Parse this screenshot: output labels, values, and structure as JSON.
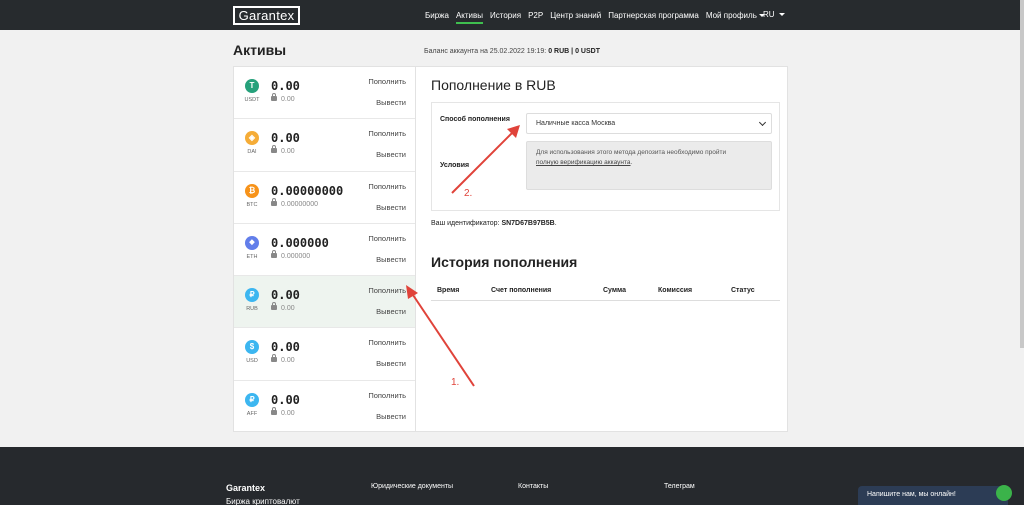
{
  "header": {
    "logo": "Garantex",
    "nav": [
      "Биржа",
      "Активы",
      "История",
      "P2P",
      "Центр знаний",
      "Партнерская программа",
      "Мой профиль"
    ],
    "active": "Активы",
    "lang": "RU"
  },
  "page": {
    "title": "Активы",
    "balance_prefix": "Баланс аккаунта на 25.02.2022 19:19:",
    "balance_rub": "0 RUB",
    "balance_sep": "|",
    "balance_usdt": "0 USDT"
  },
  "assets": [
    {
      "ticker": "USDT",
      "amount": "0.00",
      "locked": "0.00",
      "color": "#26a17b",
      "symbol": "T",
      "deposit": "Пополнить",
      "withdraw": "Вывести"
    },
    {
      "ticker": "DAI",
      "amount": "0.00",
      "locked": "0.00",
      "color": "#f5ac37",
      "symbol": "◈",
      "deposit": "Пополнить",
      "withdraw": "Вывести"
    },
    {
      "ticker": "BTC",
      "amount": "0.00000000",
      "locked": "0.00000000",
      "color": "#f7931a",
      "symbol": "₿",
      "deposit": "Пополнить",
      "withdraw": "Вывести"
    },
    {
      "ticker": "ETH",
      "amount": "0.000000",
      "locked": "0.000000",
      "color": "#627eea",
      "symbol": "◆",
      "deposit": "Пополнить",
      "withdraw": "Вывести"
    },
    {
      "ticker": "RUB",
      "amount": "0.00",
      "locked": "0.00",
      "color": "#3cb6f0",
      "symbol": "₽",
      "deposit": "Пополнить",
      "withdraw": "Вывести",
      "selected": true
    },
    {
      "ticker": "USD",
      "amount": "0.00",
      "locked": "0.00",
      "color": "#3cb6f0",
      "symbol": "$",
      "deposit": "Пополнить",
      "withdraw": "Вывести"
    },
    {
      "ticker": "AFF",
      "amount": "0.00",
      "locked": "0.00",
      "color": "#3cb6f0",
      "symbol": "₽",
      "deposit": "Пополнить",
      "withdraw": "Вывести"
    }
  ],
  "deposit": {
    "title": "Пополнение в RUB",
    "method_label": "Способ пополнения",
    "method_value": "Наличные касса Москва",
    "conditions_label": "Условия",
    "conditions_text": "Для использования этого метода депозита необходимо пройти",
    "conditions_link": "полную верификацию аккаунта",
    "conditions_end": ".",
    "id_label": "Ваш идентификатор:",
    "id_value": "SN7D67B97B5B",
    "id_end": "."
  },
  "history": {
    "title": "История пополнения",
    "columns": [
      "Время",
      "Счет пополнения",
      "Сумма",
      "Комиссия",
      "Статус"
    ]
  },
  "annotations": {
    "step1": "1.",
    "step2": "2.",
    "color": "#e0433a"
  },
  "footer": {
    "brand": "Garantex",
    "subtitle": "Биржа криптовалют",
    "legal": "Юридические документы",
    "contacts": "Контакты",
    "telegram": "Телеграм"
  },
  "chat": {
    "label": "Напишите нам, мы онлайн!"
  }
}
